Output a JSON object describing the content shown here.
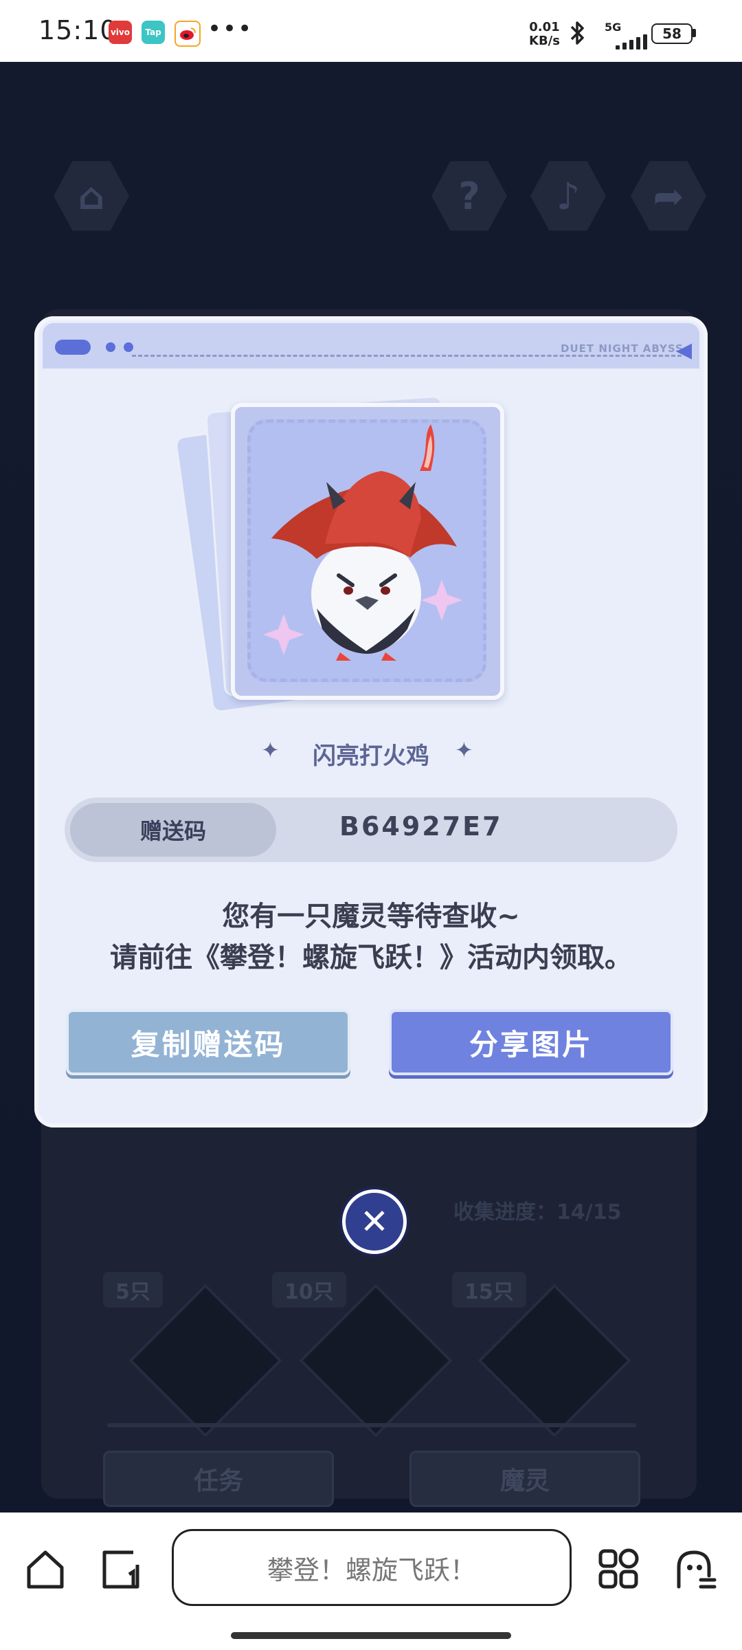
{
  "status_bar": {
    "time": "15:10",
    "app_icons": [
      {
        "name": "vivo-icon",
        "label": "vivo",
        "color": "#e03a3a"
      },
      {
        "name": "taptap-icon",
        "label": "Tap",
        "color": "#3dc4c4"
      },
      {
        "name": "weibo-icon",
        "label": "",
        "color": "#f5a623"
      }
    ],
    "more": "•••",
    "speed_value": "0.01",
    "speed_unit": "KB/s",
    "network": "5G",
    "battery": "58"
  },
  "modal": {
    "brand_text": "DUET NIGHT ABYSS",
    "creature_name": "闪亮打火鸡",
    "code_label": "赠送码",
    "code_value": "B64927E7",
    "message_line1": "您有一只魔灵等待查收~",
    "message_line2": "请前往《攀登！螺旋飞跃！》活动内领取。",
    "copy_button": "复制赠送码",
    "share_button": "分享图片",
    "close_icon": "close-icon"
  },
  "background_game": {
    "progress_label": "收集进度：",
    "progress_value": "14/15",
    "milestones": [
      "5只",
      "10只",
      "15只"
    ],
    "task_button": "任务",
    "spirit_button": "魔灵"
  },
  "bottom_bar": {
    "url_title": "攀登！螺旋飞跃！"
  },
  "colors": {
    "accent": "#6f82e0",
    "copy_button": "#93b3d4",
    "modal_bg": "#e9eefa"
  }
}
